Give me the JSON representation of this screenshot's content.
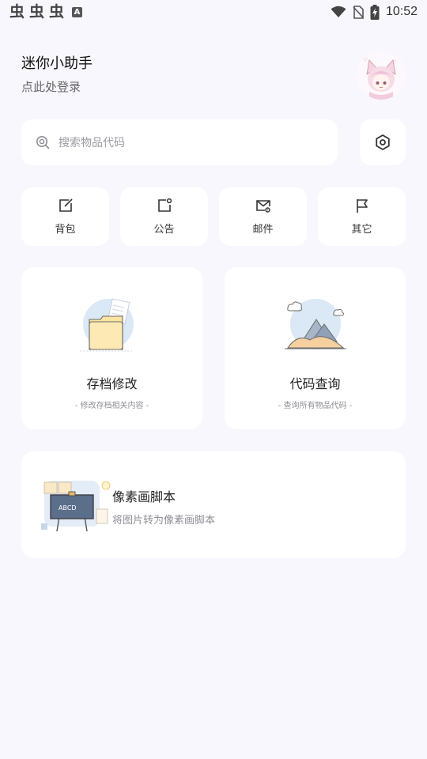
{
  "status_bar": {
    "glyphs": [
      "虫",
      "虫",
      "虫"
    ],
    "notif_letter": "A",
    "time": "10:52"
  },
  "header": {
    "title": "迷你小助手",
    "login_hint": "点此处登录"
  },
  "search": {
    "placeholder": "搜索物品代码"
  },
  "quick_actions": [
    {
      "label": "背包",
      "icon": "edit-square-icon"
    },
    {
      "label": "公告",
      "icon": "notice-icon"
    },
    {
      "label": "邮件",
      "icon": "mail-settings-icon"
    },
    {
      "label": "其它",
      "icon": "flag-icon"
    }
  ],
  "features": [
    {
      "title": "存档修改",
      "subtitle": "- 修改存档相关内容 -",
      "icon": "folder-illustration"
    },
    {
      "title": "代码查询",
      "subtitle": "- 查询所有物品代码 -",
      "icon": "mountain-illustration"
    }
  ],
  "pixel_script": {
    "title": "像素画脚本",
    "subtitle": "将图片转为像素画脚本",
    "board_text": "ABCD"
  },
  "colors": {
    "background": "#f8f7fd",
    "card": "#ffffff",
    "text_primary": "#222222",
    "text_secondary": "#8e8e96"
  }
}
